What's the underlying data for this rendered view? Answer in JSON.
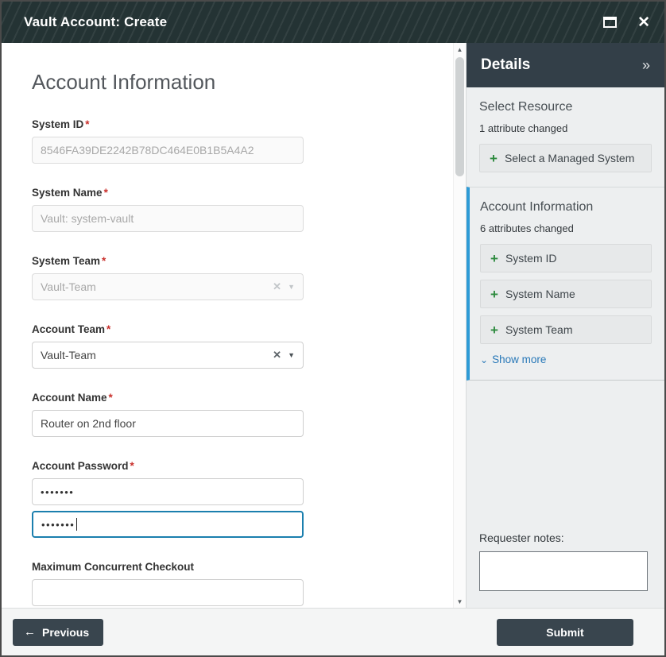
{
  "window": {
    "title": "Vault Account: Create"
  },
  "icons": {
    "close": "✕",
    "collapse_panel": "»",
    "clear": "✕",
    "caret_down": "▼",
    "plus": "+",
    "chevron_down": "⌄",
    "back_arrow": "←",
    "scroll_up": "▲",
    "scroll_down": "▼"
  },
  "form": {
    "heading": "Account Information",
    "required_marker": "*",
    "system_id": {
      "label": "System ID",
      "value": "8546FA39DE2242B78DC464E0B1B5A4A2"
    },
    "system_name": {
      "label": "System Name",
      "value": "Vault: system-vault"
    },
    "system_team": {
      "label": "System Team",
      "value": "Vault-Team"
    },
    "account_team": {
      "label": "Account Team",
      "value": "Vault-Team"
    },
    "account_name": {
      "label": "Account Name",
      "value": "Router on 2nd floor"
    },
    "account_password": {
      "label": "Account Password",
      "value": "•••••••",
      "confirm_value": "•••••••"
    },
    "max_concurrent_checkout": {
      "label": "Maximum Concurrent Checkout",
      "value": ""
    }
  },
  "details": {
    "title": "Details",
    "select_resource": {
      "heading": "Select Resource",
      "changed_text": "1 attribute changed",
      "button_label": "Select a Managed System"
    },
    "account_information": {
      "heading": "Account Information",
      "changed_text": "6 attributes changed",
      "items": [
        "System ID",
        "System Name",
        "System Team"
      ],
      "show_more_label": "Show more"
    },
    "requester_notes_label": "Requester notes:"
  },
  "footer": {
    "previous_label": "Previous",
    "submit_label": "Submit"
  },
  "colors": {
    "titlebar_bg": "#243334",
    "details_header_bg": "#333F48",
    "panel_bg": "#EDEFF0",
    "accent_blue": "#2E9BD6",
    "link_blue": "#2878B8",
    "focus_border": "#1B7FAE",
    "required_red": "#C9302C",
    "plus_green": "#2D8A3E",
    "button_dark": "#39454E"
  }
}
